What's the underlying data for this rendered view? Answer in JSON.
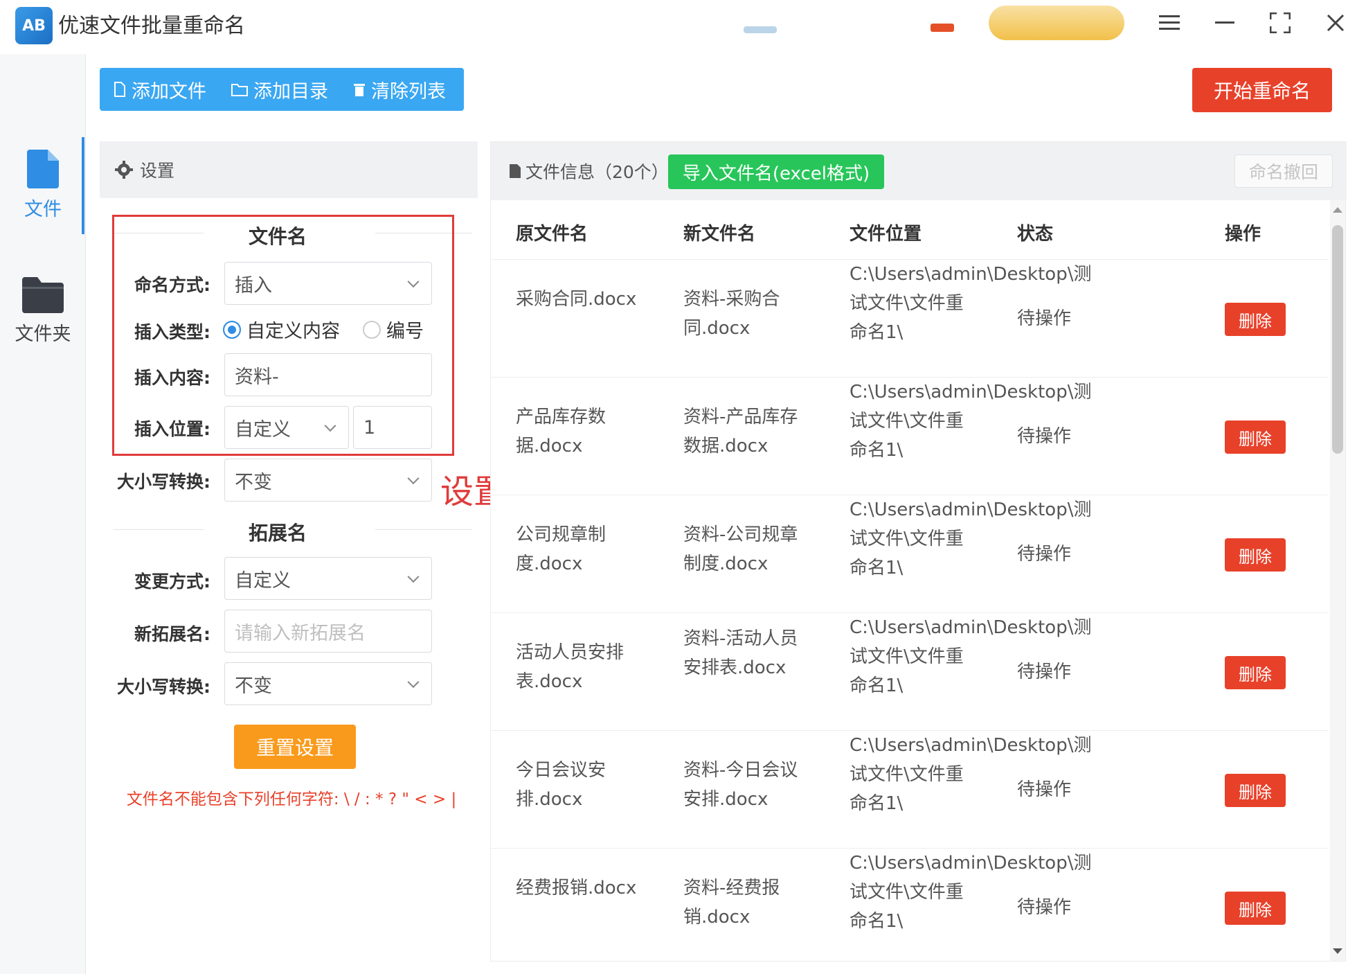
{
  "window": {
    "title": "优速文件批量重命名",
    "logo_text": "AB"
  },
  "nav": [
    {
      "label": "文件",
      "icon": "file-icon",
      "active": true
    },
    {
      "label": "文件夹",
      "icon": "folder-icon",
      "active": false
    }
  ],
  "toolbar": {
    "add_file": "添加文件",
    "add_dir": "添加目录",
    "clear_list": "清除列表",
    "start": "开始重命名"
  },
  "settings": {
    "header": "设置",
    "filename_section": "文件名",
    "naming_mode_label": "命名方式:",
    "naming_mode_value": "插入",
    "insert_type_label": "插入类型:",
    "insert_type_options": [
      "自定义内容",
      "编号"
    ],
    "insert_type_selected": "自定义内容",
    "insert_content_label": "插入内容:",
    "insert_content_value": "资料-",
    "insert_pos_label": "插入位置:",
    "insert_pos_mode": "自定义",
    "insert_pos_value": "1",
    "case_label": "大小写转换:",
    "case_value": "不变",
    "ext_section": "拓展名",
    "change_mode_label": "变更方式:",
    "change_mode_value": "自定义",
    "new_ext_label": "新拓展名:",
    "new_ext_placeholder": "请输入新拓展名",
    "ext_case_label": "大小写转换:",
    "ext_case_value": "不变",
    "reset": "重置设置",
    "warning": "文件名不能包含下列任何字符: \\ / : * ? \" < > |",
    "annotation": "设置"
  },
  "files": {
    "title": "文件信息（20个）",
    "import_btn": "导入文件名(excel格式)",
    "undo_btn": "命名撤回",
    "columns": [
      "原文件名",
      "新文件名",
      "文件位置",
      "状态",
      "操作"
    ],
    "rows": [
      {
        "orig": "采购合同.docx",
        "new": "资料-采购合同.docx",
        "path": "C:\\Users\\admin\\Desktop\\测试文件\\文件重命名1\\",
        "status": "待操作",
        "action": "删除"
      },
      {
        "orig": "产品库存数据.docx",
        "new": "资料-产品库存数据.docx",
        "path": "C:\\Users\\admin\\Desktop\\测试文件\\文件重命名1\\",
        "status": "待操作",
        "action": "删除"
      },
      {
        "orig": "公司规章制度.docx",
        "new": "资料-公司规章制度.docx",
        "path": "C:\\Users\\admin\\Desktop\\测试文件\\文件重命名1\\",
        "status": "待操作",
        "action": "删除"
      },
      {
        "orig": "活动人员安排表.docx",
        "new": "资料-活动人员安排表.docx",
        "path": "C:\\Users\\admin\\Desktop\\测试文件\\文件重命名1\\",
        "status": "待操作",
        "action": "删除"
      },
      {
        "orig": "今日会议安排.docx",
        "new": "资料-今日会议安排.docx",
        "path": "C:\\Users\\admin\\Desktop\\测试文件\\文件重命名1\\",
        "status": "待操作",
        "action": "删除"
      },
      {
        "orig": "经费报销.docx",
        "new": "资料-经费报销.docx",
        "path": "C:\\Users\\admin\\Desktop\\测试文件\\文件重命名1\\",
        "status": "待操作",
        "action": "删除"
      }
    ]
  },
  "colors": {
    "primary": "#3aa7f2",
    "danger": "#e8412a",
    "success": "#28c65a",
    "warning": "#f99a1c",
    "annotation": "#e03b3b"
  }
}
